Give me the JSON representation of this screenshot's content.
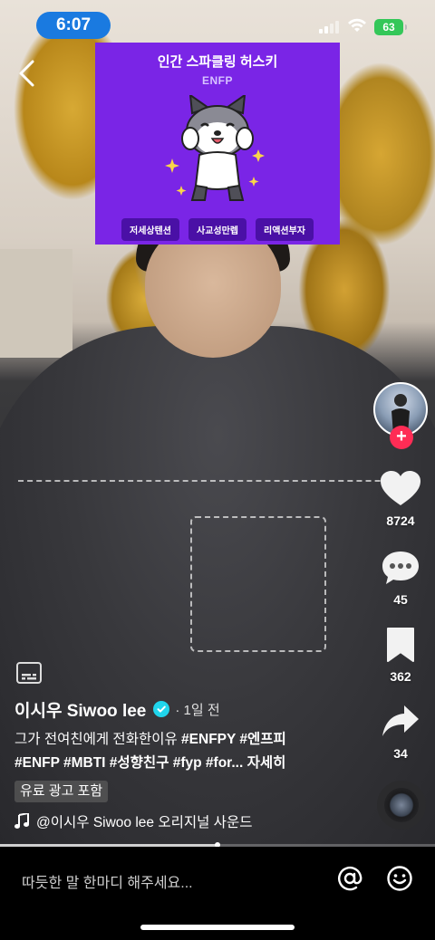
{
  "status_bar": {
    "time": "6:07",
    "battery": "63"
  },
  "mbti_card": {
    "title": "인간 스파클링 허스키",
    "type": "ENFP",
    "traits": [
      "저세상텐션",
      "사교성만렙",
      "리액션부자"
    ],
    "background_color": "#7a25e6"
  },
  "actions": {
    "likes": "8724",
    "comments": "45",
    "saves": "362",
    "shares": "34"
  },
  "post": {
    "author": "이시우 Siwoo lee",
    "time": "· 1일 전",
    "caption_line1_text": "그가 전여친에게 전화한이유 ",
    "caption_line1_tags": "#ENFPY #엔프피",
    "caption_line2_tags": "#ENFP #MBTI #성향친구 #fyp #for...",
    "caption_more": " 자세히",
    "ad_label": "유료 광고 포함",
    "sound": "@이시우 Siwoo lee 오리지널 사운드"
  },
  "playback": {
    "progress": 0.5
  },
  "comment_bar": {
    "placeholder": "따듯한 말 한마디 해주세요..."
  }
}
